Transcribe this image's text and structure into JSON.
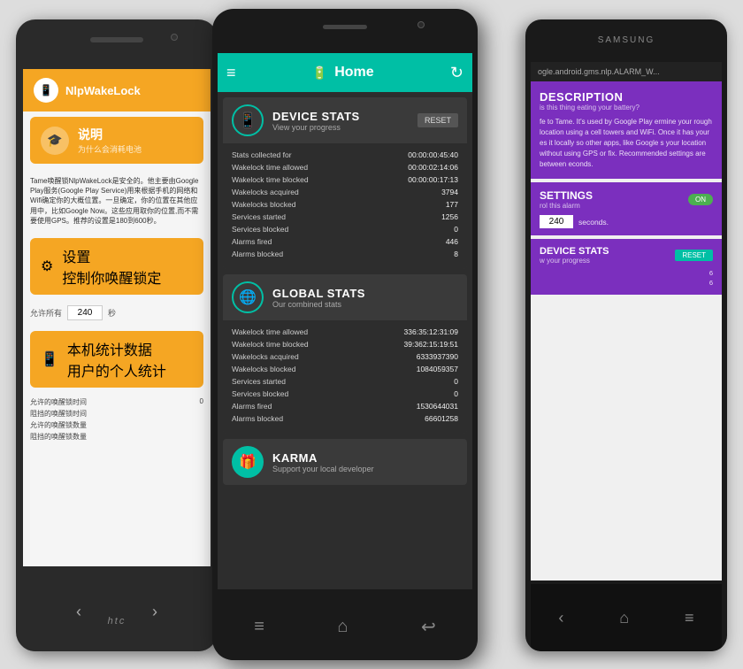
{
  "scene": {
    "bg_color": "#ddd"
  },
  "left_phone": {
    "brand": "HTC",
    "header": {
      "title": "NlpWakeLock"
    },
    "menu_items": [
      {
        "label_cn": "说明",
        "label_sub": "为什么会消耗电池",
        "icon": "🎓"
      },
      {
        "label_cn": "设置",
        "label_sub": "控制你唤醒锁定",
        "icon": "⚙"
      }
    ],
    "description": "Tame唤醒锁NlpWakeLock是安全的。他主要由Google Play服务(Google Play Service)用来根据手机的网络和Wifi确定你的大概位置。一旦确定，你的位置在其他应用中，比如Google Now。这些应用取你的位置,而不需要使用GPS。推荐的设置是180到600秒。",
    "allow_label": "允许所有",
    "allow_value": "240",
    "allow_unit": "秒",
    "stats_title": "本机统计数据",
    "stats_sub": "用户的个人统计",
    "stats_rows": [
      {
        "label": "允许的唤醒锁时间",
        "value": "0"
      },
      {
        "label": "阻挡的唤醒锁时间",
        "value": ""
      },
      {
        "label": "允许的唤醒锁数量",
        "value": ""
      },
      {
        "label": "阻挡的唤醒锁数量",
        "value": ""
      }
    ]
  },
  "center_phone": {
    "header": {
      "title": "Home",
      "menu_icon": "≡",
      "refresh_icon": "↻"
    },
    "device_stats": {
      "title": "DEVICE STATS",
      "subtitle": "View your progress",
      "reset_label": "RESET",
      "rows": [
        {
          "label": "Stats collected for",
          "value": "00:00:00:45:40"
        },
        {
          "label": "Wakelock time allowed",
          "value": "00:00:02:14:06"
        },
        {
          "label": "Wakelock time blocked",
          "value": "00:00:00:17:13"
        },
        {
          "label": "Wakelocks acquired",
          "value": "3794"
        },
        {
          "label": "Wakelocks blocked",
          "value": "177"
        },
        {
          "label": "Services started",
          "value": "1256"
        },
        {
          "label": "Services blocked",
          "value": "0"
        },
        {
          "label": "Alarms fired",
          "value": "446"
        },
        {
          "label": "Alarms blocked",
          "value": "8"
        }
      ]
    },
    "global_stats": {
      "title": "GLOBAL STATS",
      "subtitle": "Our combined stats",
      "rows": [
        {
          "label": "Wakelock time allowed",
          "value": "336:35:12:31:09"
        },
        {
          "label": "Wakelock time blocked",
          "value": "39:362:15:19:51"
        },
        {
          "label": "Wakelocks acquired",
          "value": "6333937390"
        },
        {
          "label": "Wakelocks blocked",
          "value": "1084059357"
        },
        {
          "label": "Services started",
          "value": "0"
        },
        {
          "label": "Services blocked",
          "value": "0"
        },
        {
          "label": "Alarms fired",
          "value": "1530644031"
        },
        {
          "label": "Alarms blocked",
          "value": "66601258"
        }
      ]
    },
    "karma": {
      "title": "KARMA",
      "subtitle": "Support your local developer"
    }
  },
  "right_phone": {
    "brand": "SAMSUNG",
    "header_text": "ogle.android.gms.nlp.ALARM_W...",
    "description": {
      "title": "DESCRIPTION",
      "subtitle": "is this thing eating your battery?",
      "body": "fe to Tame. It's used by Google Play ermine your rough location using a cell towers and WiFi. Once it has your es it locally so other apps, like Google s your location without using GPS or fix. Recommended settings are between econds."
    },
    "settings": {
      "title": "SETTINGS",
      "subtitle": "rol this alarm",
      "toggle_label": "ON",
      "allow_value": "240",
      "allow_unit": "seconds."
    },
    "device_stats": {
      "title": "DEVICE STATS",
      "subtitle": "w your progress",
      "reset_label": "RESET",
      "rows": [
        {
          "label": "",
          "value": "6"
        },
        {
          "label": "",
          "value": "6"
        }
      ]
    }
  }
}
